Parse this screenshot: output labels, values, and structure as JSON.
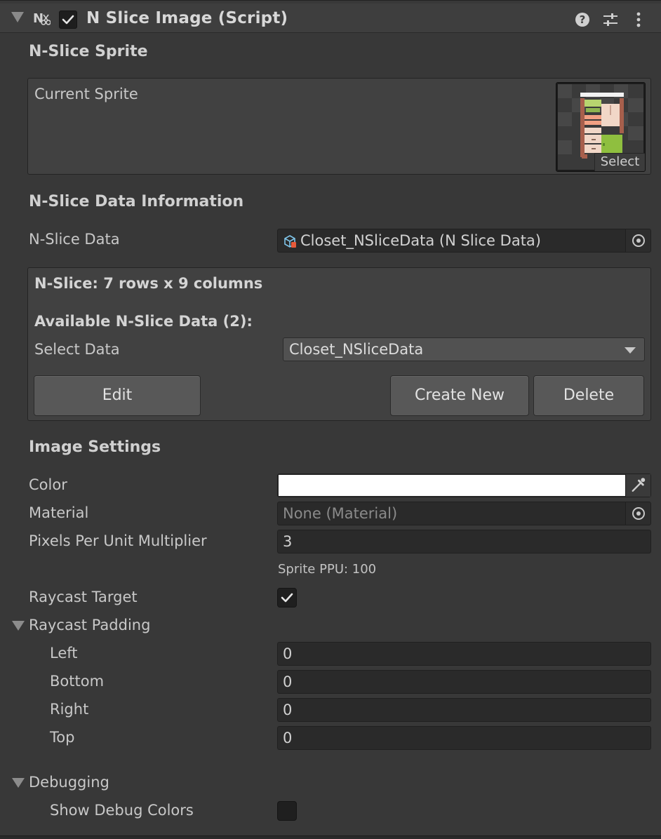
{
  "header": {
    "title": "N Slice Image (Script)",
    "enabled": true,
    "icons": [
      "script-icon",
      "help-icon",
      "preset-icon",
      "more-icon"
    ]
  },
  "sprite_section": {
    "title": "N-Slice Sprite",
    "current_sprite_label": "Current Sprite",
    "select_label": "Select"
  },
  "data_section": {
    "title": "N-Slice Data Information",
    "data_label": "N-Slice Data",
    "data_value": "Closet_NSliceData (N Slice Data)",
    "summary": "N-Slice: 7 rows x 9 columns",
    "available_label": "Available N-Slice Data (2):",
    "select_data_label": "Select Data",
    "select_data_value": "Closet_NSliceData",
    "edit_button": "Edit",
    "create_button": "Create New",
    "delete_button": "Delete"
  },
  "image_settings": {
    "title": "Image Settings",
    "color_label": "Color",
    "color_value": "#ffffff",
    "material_label": "Material",
    "material_value": "None (Material)",
    "ppu_label": "Pixels Per Unit Multiplier",
    "ppu_value": "3",
    "sprite_ppu_note": "Sprite PPU: 100",
    "raycast_target_label": "Raycast Target",
    "raycast_target_checked": true,
    "raycast_padding_label": "Raycast Padding",
    "padding": {
      "left_label": "Left",
      "left_value": "0",
      "bottom_label": "Bottom",
      "bottom_value": "0",
      "right_label": "Right",
      "right_value": "0",
      "top_label": "Top",
      "top_value": "0"
    }
  },
  "debugging": {
    "label": "Debugging",
    "show_debug_colors_label": "Show Debug Colors",
    "show_debug_colors_checked": false
  }
}
